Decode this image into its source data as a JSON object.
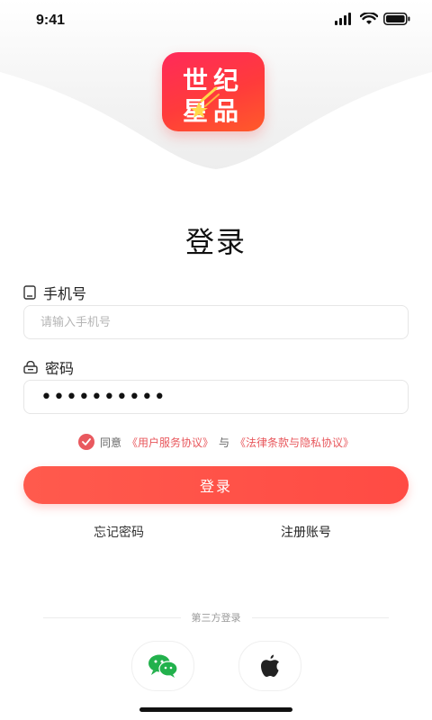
{
  "status_bar": {
    "time": "9:41"
  },
  "logo": {
    "line1": "世纪",
    "line2": "星品"
  },
  "title": "登录",
  "phone": {
    "label": "手机号",
    "placeholder": "请输入手机号",
    "value": ""
  },
  "password": {
    "label": "密码",
    "value": "••••••••••"
  },
  "agreement": {
    "prefix": "同意",
    "user_service": "《用户服务协议》",
    "and": "与",
    "legal_privacy": "《法律条款与隐私协议》"
  },
  "login_button": "登录",
  "links": {
    "forgot_password": "忘记密码",
    "register": "注册账号"
  },
  "third_party": {
    "label": "第三方登录"
  },
  "colors": {
    "accent": "#ff4b44",
    "link": "#e8575c"
  },
  "icons": {
    "phone": "phone-icon",
    "lock": "lock-icon",
    "wechat": "wechat-icon",
    "apple": "apple-icon",
    "check": "check-icon"
  }
}
